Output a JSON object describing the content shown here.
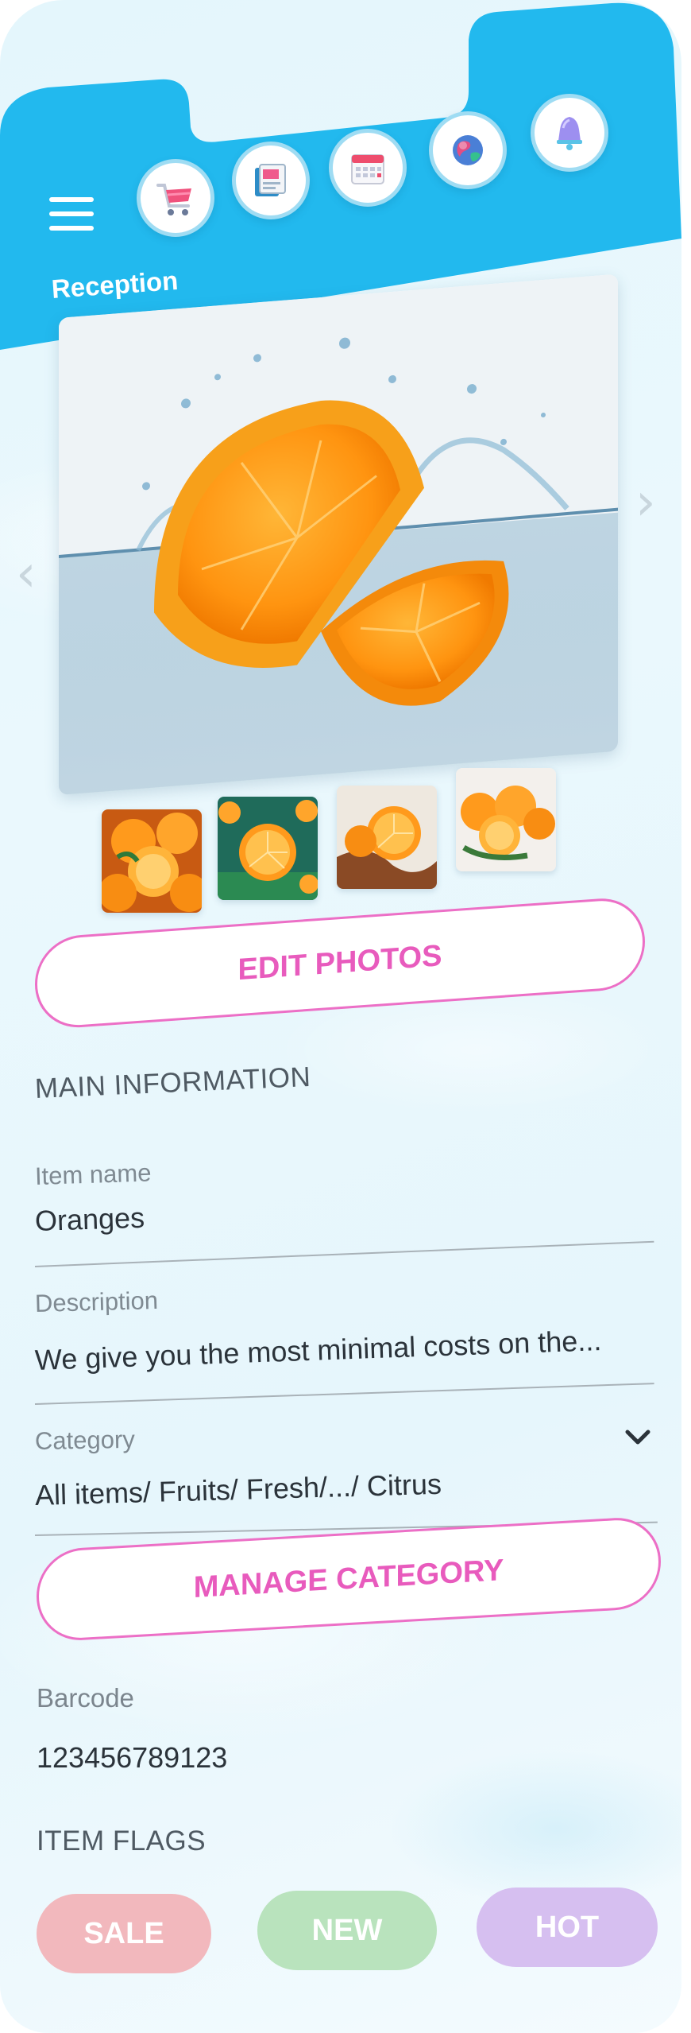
{
  "header": {
    "title": "Reception",
    "menu_icon": "hamburger-menu-icon",
    "icons": [
      {
        "name": "shopping-cart-icon"
      },
      {
        "name": "catalog-book-icon"
      },
      {
        "name": "calendar-icon"
      },
      {
        "name": "globe-icon"
      },
      {
        "name": "bell-icon"
      }
    ],
    "colors": {
      "header_bg": "#22b9ee",
      "icon_ring": "#9fdcf3"
    }
  },
  "gallery": {
    "hero_image": "orange-splash-image",
    "prev_icon": "chevron-left-icon",
    "next_icon": "chevron-right-icon",
    "prev_glyph": "‹",
    "next_glyph": "›",
    "thumbnails": [
      "orange-thumb-1",
      "orange-thumb-2",
      "orange-thumb-3",
      "orange-thumb-4"
    ],
    "edit_button": "EDIT PHOTOS"
  },
  "main_information": {
    "title": "MAIN INFORMATION",
    "item_name": {
      "label": "Item name",
      "value": "Oranges"
    },
    "description": {
      "label": "Description",
      "value": "We give you the most minimal costs on the..."
    },
    "category": {
      "label": "Category",
      "value": "All items/ Fruits/ Fresh/.../ Citrus",
      "icon": "chevron-down-icon"
    },
    "manage_button": "MANAGE CATEGORY",
    "barcode": {
      "label": "Barcode",
      "value": "123456789123"
    }
  },
  "item_flags": {
    "title": "ITEM FLAGS",
    "flags": [
      {
        "label": "SALE",
        "color": "#f2b8bd"
      },
      {
        "label": "NEW",
        "color": "#b9e3bd"
      },
      {
        "label": "HOT",
        "color": "#d6bff0"
      }
    ]
  },
  "colors": {
    "accent_pink": "#e85bbd",
    "text_dark": "#2b333a",
    "text_muted": "#7f8a92"
  }
}
